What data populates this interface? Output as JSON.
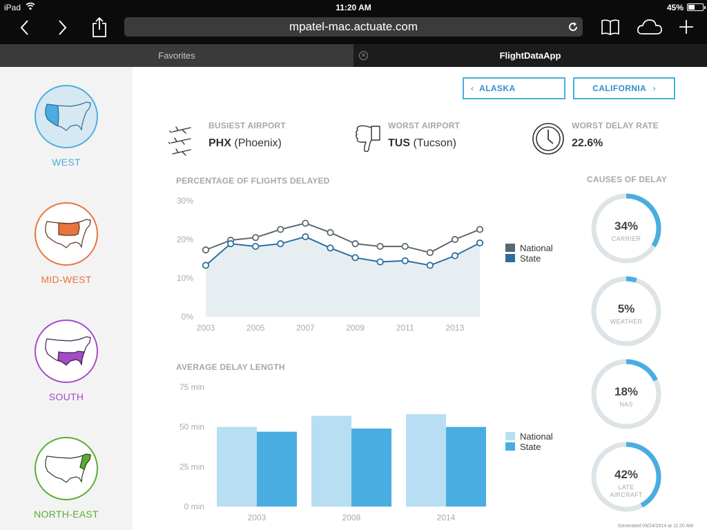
{
  "status_bar": {
    "device": "iPad",
    "time": "11:20 AM",
    "battery": "45%"
  },
  "browser": {
    "url": "mpatel-mac.actuate.com",
    "tabs": [
      {
        "label": "Favorites"
      },
      {
        "label": "FlightDataApp"
      }
    ]
  },
  "sidebar": {
    "regions": [
      {
        "label": "WEST",
        "color": "#4aaee0"
      },
      {
        "label": "MID-WEST",
        "color": "#e8743b"
      },
      {
        "label": "SOUTH",
        "color": "#a24cc8"
      },
      {
        "label": "NORTH-EAST",
        "color": "#5aab34"
      }
    ]
  },
  "nav": {
    "prev_label": "ALASKA",
    "next_label": "CALIFORNIA"
  },
  "stats": {
    "busiest": {
      "title": "BUSIEST AIRPORT",
      "code": "PHX",
      "name": "(Phoenix)"
    },
    "worst": {
      "title": "WORST AIRPORT",
      "code": "TUS",
      "name": "(Tucson)"
    },
    "delay_rate": {
      "title": "WORST DELAY RATE",
      "value": "22.6%"
    }
  },
  "colors": {
    "national_line": "#5c6870",
    "state_line": "#2b6e9e",
    "national_bar": "#b7def2",
    "state_bar": "#49ade1",
    "donut_track": "#dde3e6",
    "donut_arc": "#49ade1"
  },
  "chart_data": [
    {
      "type": "line",
      "title": "PERCENTAGE OF FLIGHTS DELAYED",
      "x": [
        2003,
        2004,
        2005,
        2006,
        2007,
        2008,
        2009,
        2010,
        2011,
        2012,
        2013,
        2014
      ],
      "x_ticks": [
        "2003",
        "2005",
        "2007",
        "2009",
        "2011",
        "2013"
      ],
      "y_ticks": [
        "0%",
        "10%",
        "20%",
        "30%"
      ],
      "ylim": [
        0,
        30
      ],
      "series": [
        {
          "name": "National",
          "values": [
            17.3,
            19.8,
            20.5,
            22.6,
            24.2,
            21.8,
            18.9,
            18.2,
            18.2,
            16.6,
            20.0,
            22.6
          ]
        },
        {
          "name": "State",
          "values": [
            13.3,
            18.9,
            18.2,
            18.9,
            20.7,
            17.8,
            15.3,
            14.2,
            14.5,
            13.3,
            15.8,
            19.1
          ]
        }
      ],
      "legend": "right"
    },
    {
      "type": "bar",
      "title": "AVERAGE DELAY LENGTH",
      "categories": [
        "2003",
        "2008",
        "2014"
      ],
      "y_ticks": [
        "0 min",
        "25 min",
        "50 min",
        "75 min"
      ],
      "ylim": [
        0,
        75
      ],
      "series": [
        {
          "name": "National",
          "values": [
            50,
            57,
            58
          ]
        },
        {
          "name": "State",
          "values": [
            47,
            49,
            50
          ]
        }
      ],
      "legend": "right"
    },
    {
      "type": "pie",
      "title": "CAUSES OF DELAY",
      "slices": [
        {
          "label": "CARRIER",
          "value": 34,
          "text": "34%"
        },
        {
          "label": "WEATHER",
          "value": 5,
          "text": "5%"
        },
        {
          "label": "NAS",
          "value": 18,
          "text": "18%"
        },
        {
          "label": "LATE AIRCRAFT",
          "value": 42,
          "text": "42%"
        }
      ]
    }
  ],
  "footer": {
    "generated": "Generated 09/24/2014 at 11:20 AM"
  }
}
